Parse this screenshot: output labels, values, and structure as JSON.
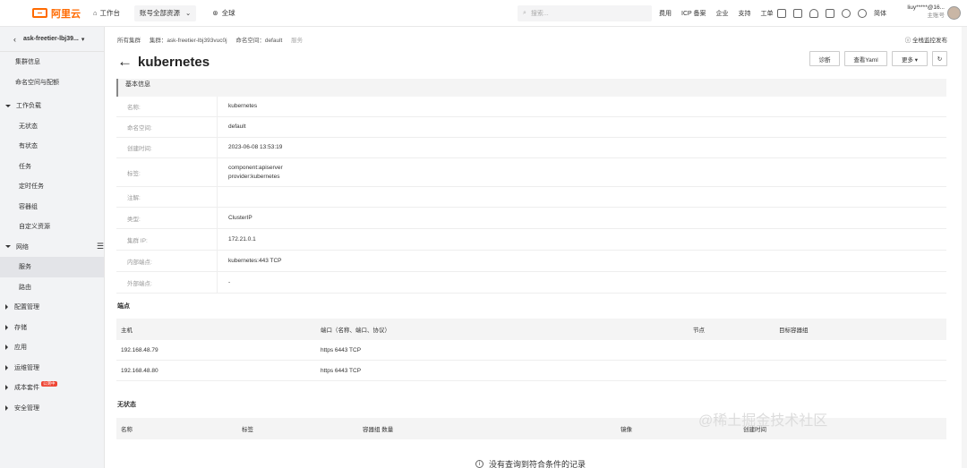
{
  "topbar": {
    "logo": "阿里云",
    "workbench": "工作台",
    "resource": "账号全部资源",
    "region": "全球",
    "search_placeholder": "搜索...",
    "links": [
      "费用",
      "ICP 备案",
      "企业",
      "支持",
      "工单"
    ],
    "lang": "简体",
    "user": "liuy*****@16...",
    "user_sub": "主账号"
  },
  "sidebar": {
    "cluster": "ask-freetier-lbj39...",
    "items": [
      "集群信息",
      "命名空间与配额"
    ],
    "groups": [
      {
        "label": "工作负载",
        "children": [
          "无状态",
          "有状态",
          "任务",
          "定时任务",
          "容器组",
          "自定义资源"
        ]
      },
      {
        "label": "网络",
        "children": [
          "服务",
          "路由"
        ]
      }
    ],
    "collapsed": [
      "配置管理",
      "存储",
      "应用",
      "运维管理",
      "成本套件",
      "安全管理"
    ],
    "badge": "公测中"
  },
  "main": {
    "breadcrumb": [
      "所有集群",
      "集群：ask-freetier-lbj393vuc0j",
      "命名空间：default",
      "服务"
    ],
    "help": "全栈监控发布",
    "title": "kubernetes",
    "buttons": [
      "诊断",
      "查看Yaml",
      "更多 ▾",
      "↻"
    ],
    "basic_title": "基本信息",
    "basic": [
      {
        "k": "名称:",
        "v": [
          "kubernetes"
        ]
      },
      {
        "k": "命名空间:",
        "v": [
          "default"
        ]
      },
      {
        "k": "创建时间:",
        "v": [
          "2023-06-08 13:53:19"
        ]
      },
      {
        "k": "标签:",
        "v": [
          "component:apiserver",
          "provider:kubernetes"
        ]
      },
      {
        "k": "注解:",
        "v": [
          ""
        ]
      },
      {
        "k": "类型:",
        "v": [
          "ClusterIP"
        ]
      },
      {
        "k": "集群 IP:",
        "v": [
          "172.21.0.1"
        ]
      },
      {
        "k": "内部端点:",
        "v": [
          "kubernetes:443 TCP"
        ]
      },
      {
        "k": "外部端点:",
        "v": [
          "-"
        ]
      }
    ],
    "endpoints_title": "端点",
    "endpoints_headers": [
      "主机",
      "端口（名称、端口、协议）",
      "节点",
      "目标容器组"
    ],
    "endpoints_rows": [
      [
        "192.168.48.79",
        "https 6443 TCP",
        "",
        ""
      ],
      [
        "192.168.48.80",
        "https 6443 TCP",
        "",
        ""
      ]
    ],
    "stateless_title": "无状态",
    "stateless_headers": [
      "名称",
      "标签",
      "容器组 数量",
      "镜像",
      "创建时间"
    ],
    "empty_text": "没有查询到符合条件的记录"
  },
  "watermark": "@稀土掘金技术社区"
}
